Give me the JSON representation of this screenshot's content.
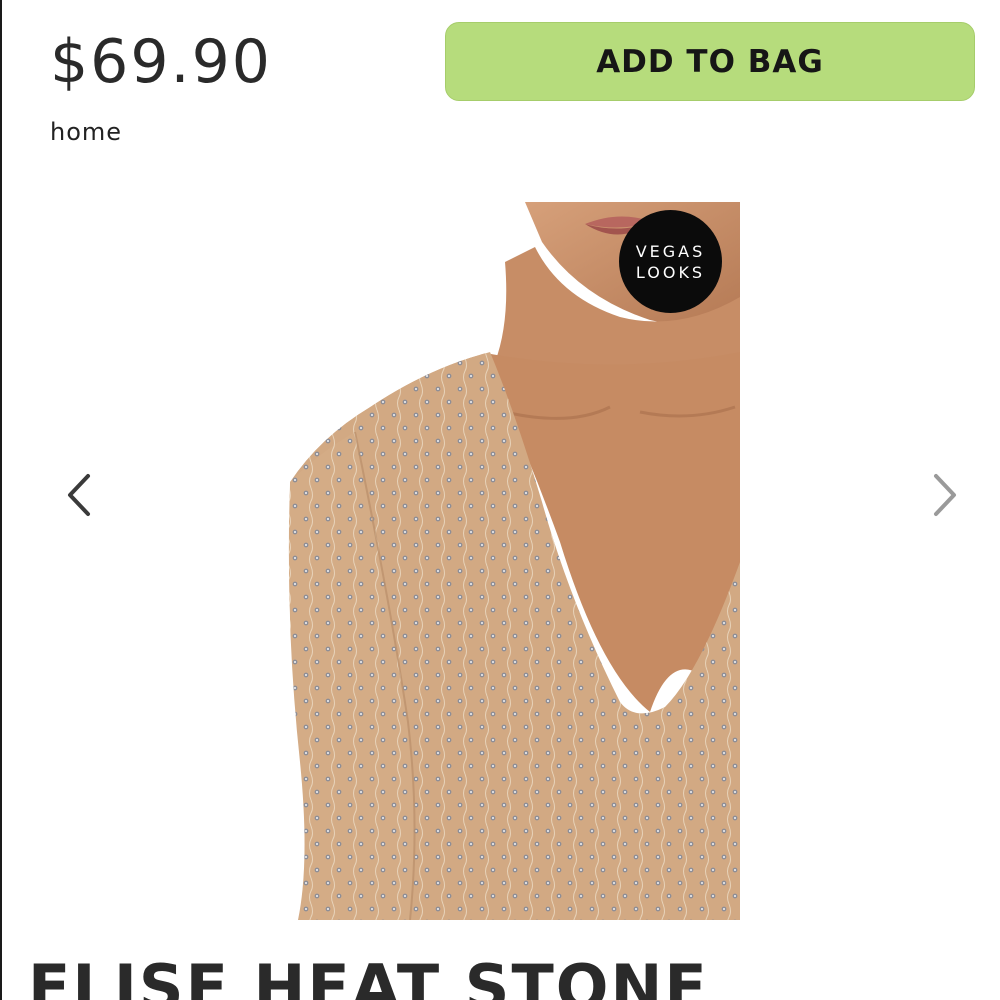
{
  "product": {
    "price": "$69.90",
    "title": "ELISE HEAT STONE"
  },
  "actions": {
    "add_to_bag_label": "ADD TO BAG"
  },
  "breadcrumb": {
    "label": "home"
  },
  "gallery": {
    "badge_line1": "VEGAS",
    "badge_line2": "LOOKS",
    "prev_icon": "chevron-left-icon",
    "next_icon": "chevron-right-icon"
  },
  "colors": {
    "accent_button": "#b6dc7c",
    "badge_bg": "#0b0b0b",
    "text": "#2a2a2a",
    "fabric": "#d2a983",
    "skin": "#c48a64"
  }
}
